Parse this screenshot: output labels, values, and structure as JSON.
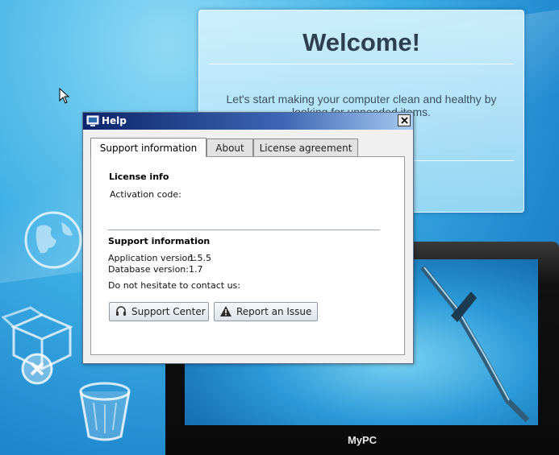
{
  "welcome": {
    "title": "Welcome!",
    "text": "Let's start making your computer clean and healthy by looking for unneeded items."
  },
  "laptop": {
    "brand": "MyPC"
  },
  "dialog": {
    "title": "Help",
    "tabs": [
      {
        "label": "Support information",
        "active": true
      },
      {
        "label": "About",
        "active": false
      },
      {
        "label": "License agreement",
        "active": false
      }
    ],
    "license_info": {
      "heading": "License info",
      "activation_label": "Activation code:"
    },
    "support_info": {
      "heading": "Support information",
      "app_version_label": "Application version:",
      "app_version": "1.5.5",
      "db_version_label": "Database version:",
      "db_version": "1.7",
      "contact_text": "Do not hesitate to contact us:"
    },
    "buttons": {
      "support_center": "Support Center",
      "report_issue": "Report an Issue"
    }
  },
  "colors": {
    "title_bar_start": "#0b246a",
    "title_bar_end": "#a6caf0",
    "desktop_blue": "#1e86cd"
  }
}
